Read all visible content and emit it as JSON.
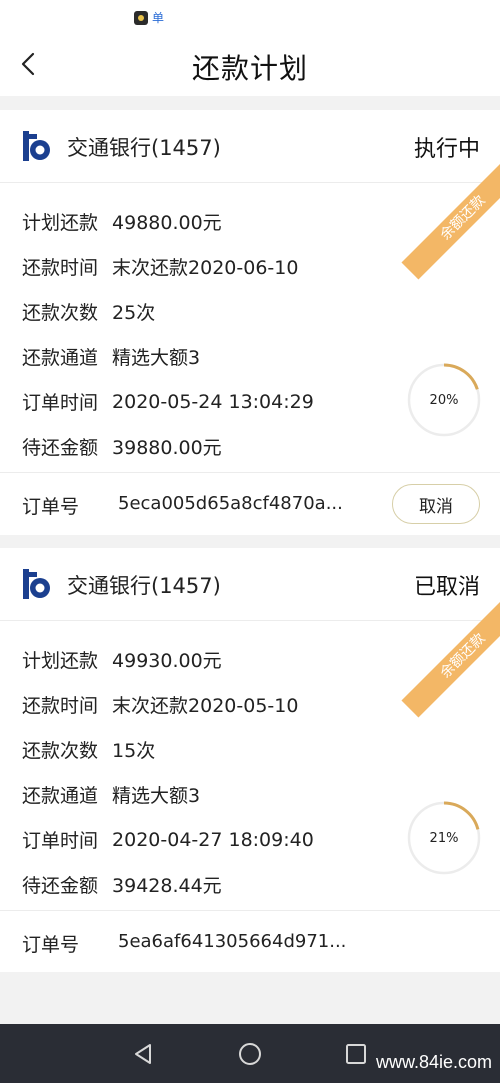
{
  "status_bar": {
    "icons": [
      "app-icon",
      "message-icon"
    ],
    "message_glyph": "单"
  },
  "header": {
    "title": "还款计划",
    "back_icon": "chevron-left-icon"
  },
  "plans": [
    {
      "bank_name": "交通银行(1457)",
      "status": "执行中",
      "ribbon": "余额还款",
      "rows": [
        {
          "label": "计划还款",
          "value": "49880.00元"
        },
        {
          "label": "还款时间",
          "value": "末次还款2020-06-10"
        },
        {
          "label": "还款次数",
          "value": "25次"
        },
        {
          "label": "还款通道",
          "value": "精选大额3"
        },
        {
          "label": "订单时间",
          "value": "2020-05-24 13:04:29"
        },
        {
          "label": "待还金额",
          "value": "39880.00元"
        }
      ],
      "progress_text": "20%",
      "progress_fraction": 0.2,
      "order_label": "订单号",
      "order_value": "5eca005d65a8cf4870a...",
      "cancel_label": "取消"
    },
    {
      "bank_name": "交通银行(1457)",
      "status": "已取消",
      "ribbon": "余额还款",
      "rows": [
        {
          "label": "计划还款",
          "value": "49930.00元"
        },
        {
          "label": "还款时间",
          "value": "末次还款2020-05-10"
        },
        {
          "label": "还款次数",
          "value": "15次"
        },
        {
          "label": "还款通道",
          "value": "精选大额3"
        },
        {
          "label": "订单时间",
          "value": "2020-04-27 18:09:40"
        },
        {
          "label": "待还金额",
          "value": "39428.44元"
        }
      ],
      "progress_text": "21%",
      "progress_fraction": 0.21,
      "order_label": "订单号",
      "order_value": "5ea6af641305664d971..."
    }
  ],
  "colors": {
    "accent": "#f3b766",
    "progress_arc": "#d9a95a",
    "progress_track": "#ececec",
    "bank_blue": "#1b3f8f",
    "nav_bar": "#2a2d35"
  },
  "nav": {
    "icons": [
      "triangle-back-icon",
      "circle-home-icon",
      "square-recent-icon"
    ]
  },
  "watermark": "www.84ie.com"
}
